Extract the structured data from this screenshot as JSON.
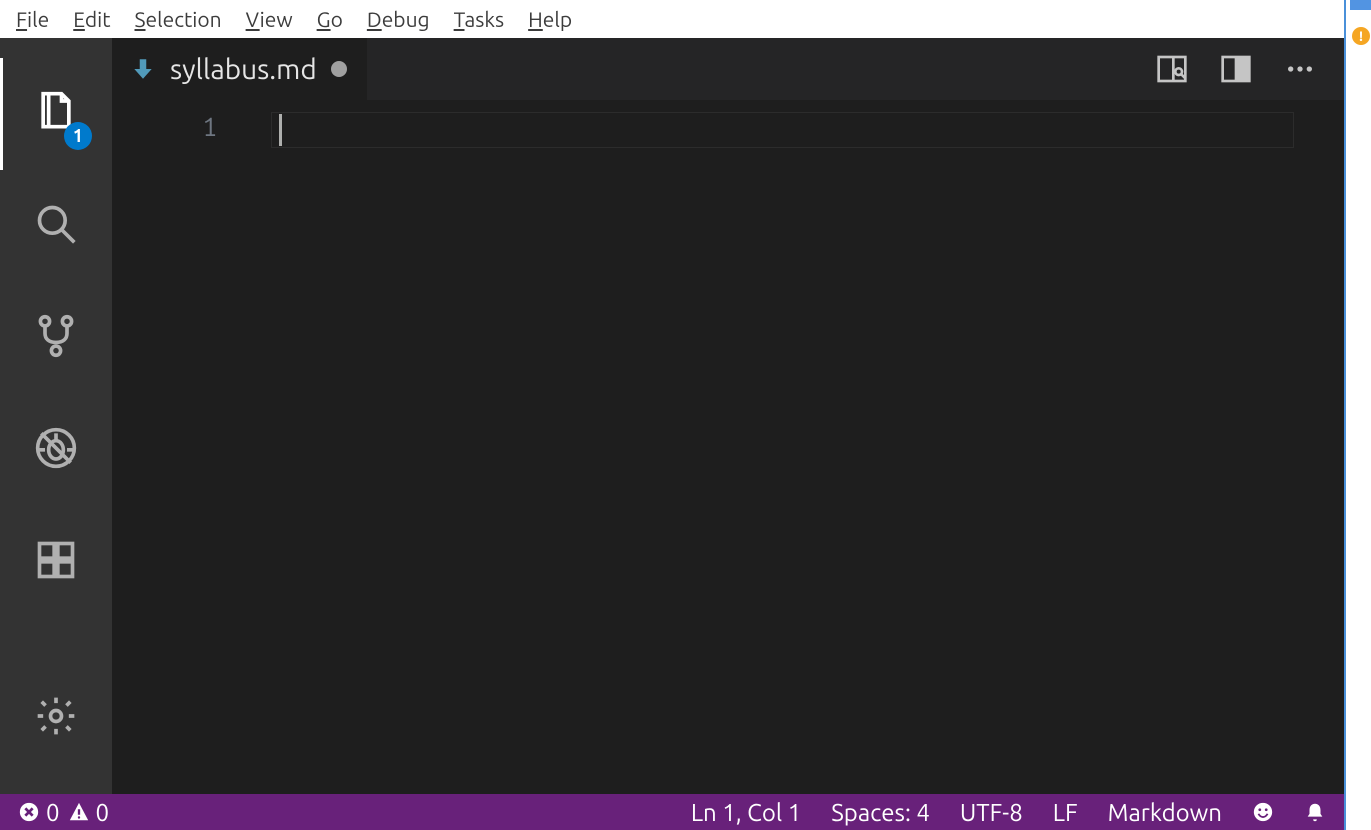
{
  "menu": {
    "items": [
      "File",
      "Edit",
      "Selection",
      "View",
      "Go",
      "Debug",
      "Tasks",
      "Help"
    ]
  },
  "activitybar": {
    "explorer_badge": "1"
  },
  "tab": {
    "filename": "syllabus.md"
  },
  "editor": {
    "line_number": "1"
  },
  "status": {
    "errors": "0",
    "warnings": "0",
    "cursor": "Ln 1, Col 1",
    "spaces": "Spaces: 4",
    "encoding": "UTF-8",
    "eol": "LF",
    "language": "Markdown"
  },
  "right_sliver": {
    "badge": "!"
  }
}
